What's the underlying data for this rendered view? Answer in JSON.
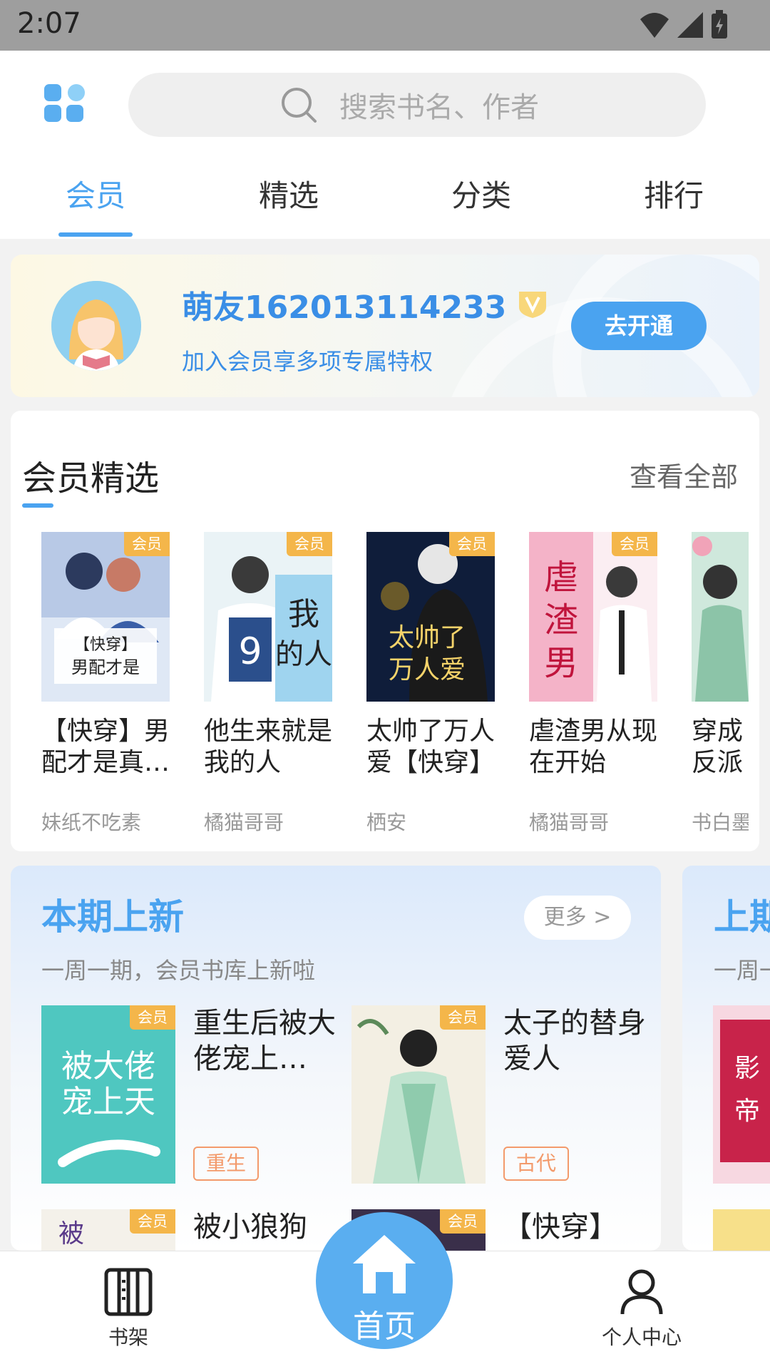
{
  "status_bar": {
    "time": "2:07"
  },
  "search": {
    "placeholder": "搜索书名、作者"
  },
  "tabs": [
    {
      "label": "会员",
      "active": true
    },
    {
      "label": "精选"
    },
    {
      "label": "分类"
    },
    {
      "label": "排行"
    }
  ],
  "member": {
    "username": "萌友162013114233",
    "subtitle": "加入会员享多项专属特权",
    "open_label": "去开通"
  },
  "picks": {
    "title": "会员精选",
    "more_label": "查看全部",
    "books": [
      {
        "badge": "会员",
        "title": "【快穿】男配才是真…",
        "author": "妹纸不吃素"
      },
      {
        "badge": "会员",
        "title": "他生来就是我的人",
        "author": "橘猫哥哥"
      },
      {
        "badge": "会员",
        "title": "太帅了万人爱【快穿】",
        "author": "栖安"
      },
      {
        "badge": "会员",
        "title": "虐渣男从现在开始",
        "author": "橘猫哥哥"
      },
      {
        "title": "穿成反派",
        "author": "书白墨"
      }
    ]
  },
  "new_releases": {
    "title": "本期上新",
    "more_label": "更多 >",
    "subtitle": "一周一期，会员书库上新啦",
    "books": [
      {
        "badge": "会员",
        "title": "重生后被大佬宠上…",
        "tag": "重生"
      },
      {
        "badge": "会员",
        "title": "太子的替身爱人",
        "tag": "古代"
      },
      {
        "badge": "会员",
        "title": "被小狼狗"
      },
      {
        "badge": "会员",
        "title": "【快穿】"
      }
    ]
  },
  "prev_releases": {
    "title": "上期",
    "subtitle": "一周一"
  },
  "bottom_nav": {
    "shelf": "书架",
    "home": "首页",
    "profile": "个人中心"
  },
  "colors": {
    "accent": "#4aa3f0",
    "badge": "#f4b64a",
    "tag": "#f39a6b"
  }
}
